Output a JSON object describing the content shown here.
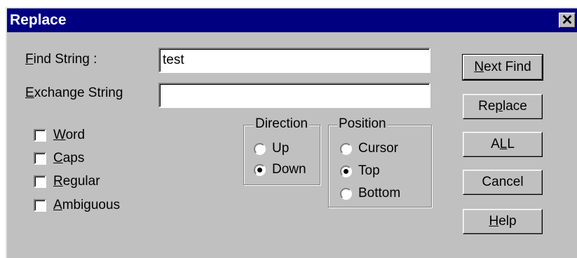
{
  "dialog": {
    "title": "Replace"
  },
  "labels": {
    "find": "Find String :",
    "exchange": "Exchange String"
  },
  "inputs": {
    "find_value": "test",
    "exchange_value": ""
  },
  "options": [
    "Word",
    "Caps",
    "Regular",
    "Ambiguous"
  ],
  "direction": {
    "title": "Direction",
    "items": [
      "Up",
      "Down"
    ],
    "selected": "Down"
  },
  "position": {
    "title": "Position",
    "items": [
      "Cursor",
      "Top",
      "Bottom"
    ],
    "selected": "Top"
  },
  "buttons": {
    "next_find": "Next Find",
    "replace": "Replace",
    "all": "ALL",
    "cancel": "Cancel",
    "help": "Help"
  },
  "colors": {
    "titlebar": "#000080",
    "face": "#c0c0c0"
  }
}
